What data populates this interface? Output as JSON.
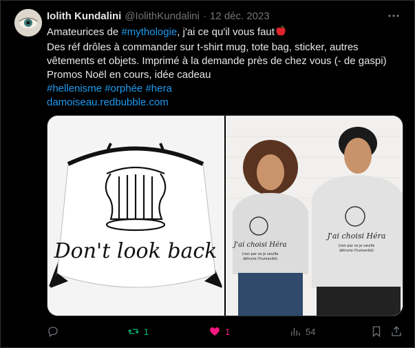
{
  "author": {
    "name": "Iolith Kundalini",
    "handle": "@IolithKundalini",
    "separator": "·",
    "date": "12 déc. 2023"
  },
  "tweet": {
    "line1_prefix": "Amateurices de ",
    "line1_hashtag": "#mythologie",
    "line1_suffix": ", j'ai ce qu'il vous faut",
    "line2": "Des réf drôles à commander sur t-shirt mug, tote bag, sticker, autres",
    "line3": "vêtements et objets. Imprimé à la demande près de chez vous (- de gaspi)",
    "line4": "Promos Noël en cours, idée cadeau",
    "hashtags": [
      "#hellenisme",
      "#orphée",
      "#hera"
    ],
    "link": "damoiseau.redbubble.com"
  },
  "media": {
    "left_caption": "Don't look back",
    "right_shirt_line1": "J'ai choisi Héra",
    "right_shirt_line2": "(non par ce je veuille",
    "right_shirt_line3": "détruire l'humanité)"
  },
  "actions": {
    "reply_count": "",
    "retweet_count": "1",
    "like_count": "1",
    "views_count": "54"
  },
  "colors": {
    "accent": "#1d9bf0",
    "retweet": "#00ba7c",
    "like": "#f91880",
    "muted": "#71767b"
  }
}
